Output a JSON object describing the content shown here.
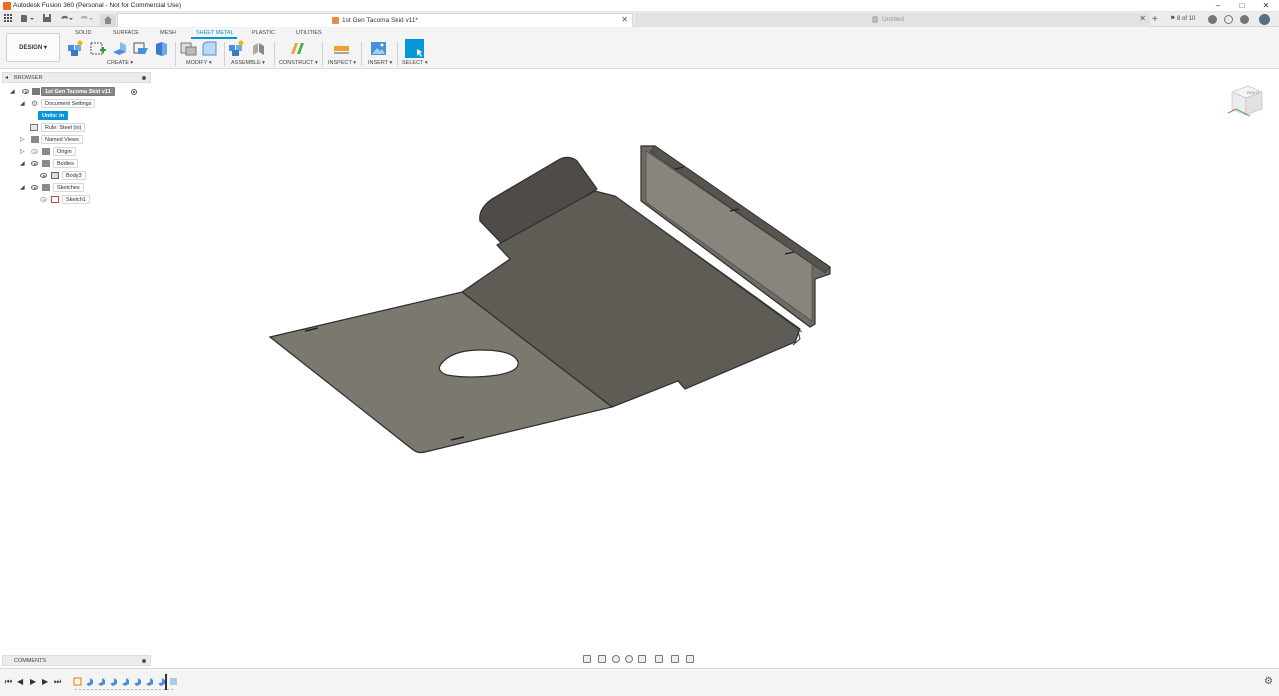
{
  "window": {
    "title": "Autodesk Fusion 360 (Personal - Not for Commercial Use)",
    "minimize": "–",
    "maximize": "□",
    "close": "✕"
  },
  "tabs": {
    "active": {
      "label": "1st Gen Tacoma Skid v11*",
      "close": "✕"
    },
    "inactive": {
      "label": "Untitled",
      "close": "✕"
    },
    "new_tab": "+",
    "job_status": "8 of 10"
  },
  "toolbar": {
    "workspace": "DESIGN ▾",
    "workspace_tabs": [
      "SOLID",
      "SURFACE",
      "MESH",
      "SHEET METAL",
      "PLASTIC",
      "UTILITIES"
    ],
    "active_tab": "SHEET METAL",
    "groups": {
      "create": "CREATE ▾",
      "modify": "MODIFY ▾",
      "assemble": "ASSEMBLE ▾",
      "construct": "CONSTRUCT ▾",
      "inspect": "INSPECT ▾",
      "insert": "INSERT ▾",
      "select": "SELECT ▾"
    },
    "accent_color": "#0696d7"
  },
  "browser": {
    "title": "BROWSER",
    "root": "1st Gen Tacoma Skid v11",
    "document_settings": "Document Settings",
    "units": "Units: in",
    "rule": "Rule: Steel (in)",
    "named_views": "Named Views",
    "origin": "Origin",
    "bodies": "Bodies",
    "body": "Body3",
    "sketches": "Sketches",
    "sketch": "Sketch1"
  },
  "viewcube": {
    "face": "RIGHT"
  },
  "comments": {
    "title": "COMMENTS"
  },
  "model": {
    "color": "#6b6862"
  }
}
